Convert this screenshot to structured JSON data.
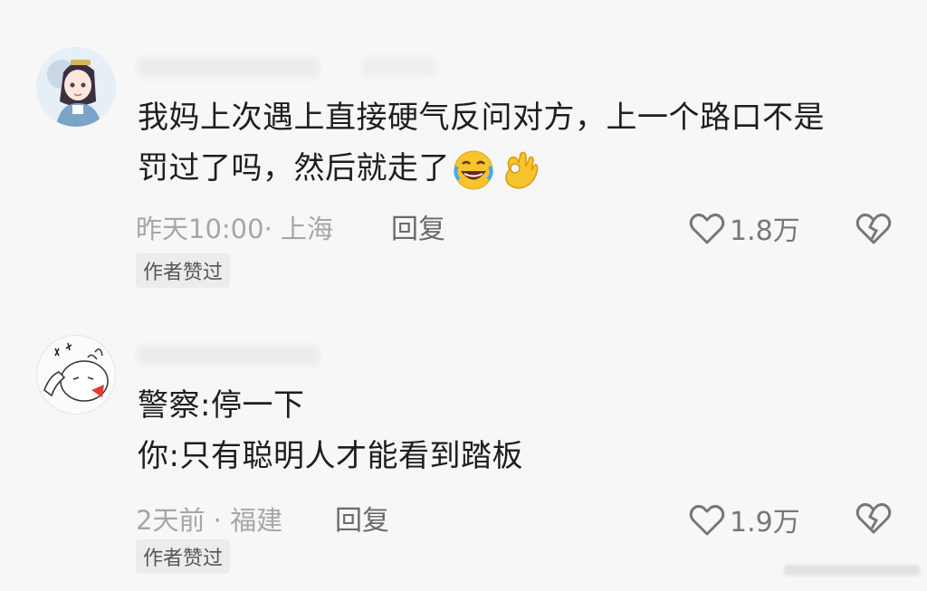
{
  "comments": [
    {
      "avatar_icon": "anime-girl-avatar-icon",
      "lines": [
        "我妈上次遇上直接硬气反问对方，上一个路口不是",
        "罚过了吗，然后就走了"
      ],
      "emojis": [
        "rolling-laughing-emoji",
        "ok-hand-emoji"
      ],
      "meta": "昨天10:00· 上海",
      "reply_label": "回复",
      "likes": "1.8万",
      "badge": "作者赞过"
    },
    {
      "avatar_icon": "cartoon-rabbit-avatar-icon",
      "lines": [
        "警察:停一下",
        "你:只有聪明人才能看到踏板"
      ],
      "meta": "2天前 · 福建",
      "reply_label": "回复",
      "likes": "1.9万",
      "badge": "作者赞过"
    }
  ],
  "colors": {
    "background": "#f7f7f7",
    "text": "#1e1e1e",
    "meta": "#a6a6a6",
    "badge_bg": "#ececec"
  }
}
